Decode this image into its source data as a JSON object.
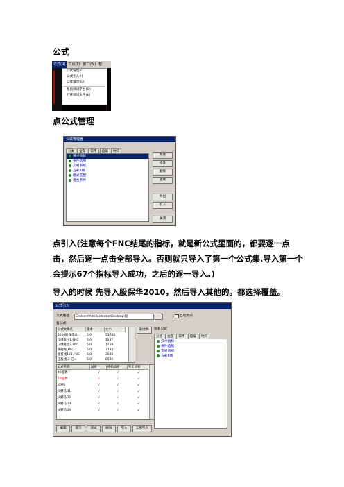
{
  "heading1": "公式",
  "menu_screenshot": {
    "menubar": [
      "公式(R)",
      "工具(T)",
      "窗口(W)",
      "帮"
    ],
    "items": [
      "公式管理(F)",
      "公式引入(I)",
      "公式输出(E)",
      "系统测试平台(O)",
      "打开测试文件(K)"
    ]
  },
  "heading2": "点公式管理",
  "manager_screenshot": {
    "title": "公式管理器",
    "tabs": [
      "分类",
      "全部",
      "常用",
      "自编",
      "时间"
    ],
    "list": [
      "技术指标",
      "条件选股",
      "交易系统",
      "五彩K线",
      "模式匹配",
      "组合条件"
    ],
    "buttons": [
      "新建",
      "修改",
      "删除",
      "查找",
      "导出",
      "引入",
      "关闭"
    ]
  },
  "paragraph1": "点引入(注意每个FNC结尾的指标，就是新公式里面的，都要逐一点击，然后逐一点击全部导入。否则就只导入了第一个公式集.导入第一个会提示67个指标导入成功，之后的逐一导入。)",
  "paragraph2": "导入的时候 先导入股保华2010，然后导入其他的。都选择覆盖。",
  "import_screenshot": {
    "title": "公式引入",
    "path_label": "公式路径",
    "path_value": "C:\\Users\\Administrator\\Desktop\\股",
    "browse": "...",
    "auto_test": "自动测试",
    "left_group": "备公式",
    "right_group": "现有公式",
    "file_columns": [
      "公式文件名",
      "版本",
      "大小"
    ],
    "files": [
      [
        "2010股保华公...",
        "5.0",
        "53783"
      ],
      [
        "J2爆盘拉1.FNC",
        "5.0",
        "1247"
      ],
      [
        "J3爆盘拉2.FNC",
        "5.0",
        "1758"
      ],
      [
        "突破龙.FNC",
        "5.0",
        "3784"
      ],
      [
        "极贫线123.FNC",
        "5.0",
        "3640"
      ],
      [
        "庄股线(2.已...",
        "5.0",
        "8586"
      ]
    ],
    "delete_file": "删文件",
    "formula_columns": [
      "公式名称",
      "加密",
      "密码加密",
      "完全加密"
    ],
    "formulas": [
      [
        "40临界",
        "√",
        "√",
        "√"
      ],
      [
        "50临界",
        "√",
        "√",
        "√"
      ],
      [
        "ICMS",
        "√",
        "√",
        "√"
      ],
      [
        "J8野马D1",
        "√",
        "√",
        "√"
      ],
      [
        "J8野马D2",
        "√",
        "√",
        "√"
      ],
      [
        "J8野马D3",
        "√",
        "√",
        "√"
      ],
      [
        "J8野马D4",
        "√",
        "√",
        "√"
      ]
    ],
    "right_tabs": [
      "分组",
      "全部",
      "常用",
      "自编",
      "时间"
    ],
    "existing": [
      "技术指标",
      "条件选股",
      "交易系统",
      "五彩K线"
    ],
    "buttons": [
      "编辑",
      "提示",
      "测试",
      "删除",
      "引入",
      "全部引入"
    ]
  }
}
